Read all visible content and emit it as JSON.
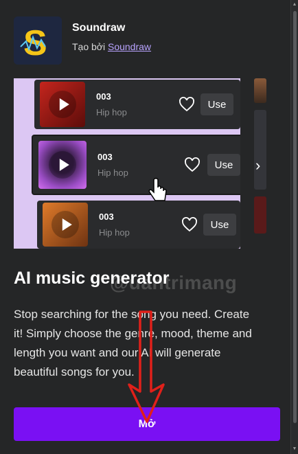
{
  "app": {
    "name": "Soundraw",
    "author_prefix": "Tạo bởi",
    "author_link": "Soundraw"
  },
  "preview": {
    "tracks": [
      {
        "number": "003",
        "genre": "Hip hop",
        "use_label": "Use"
      },
      {
        "number": "003",
        "genre": "Hip hop",
        "use_label": "Use"
      },
      {
        "number": "003",
        "genre": "Hip hop",
        "use_label": "Use"
      }
    ]
  },
  "headline": "AI music generator",
  "watermark": "@uantrimang",
  "description": "Stop searching for the song you need. Create it! Simply choose the genre, mood, theme and length you want and our AI will generate beautiful songs for you.",
  "open_button": "Mở",
  "colors": {
    "background": "#252627",
    "accent": "#7a10f3",
    "preview_bg": "#dcc7f3",
    "annotation_arrow": "#e0201a"
  }
}
